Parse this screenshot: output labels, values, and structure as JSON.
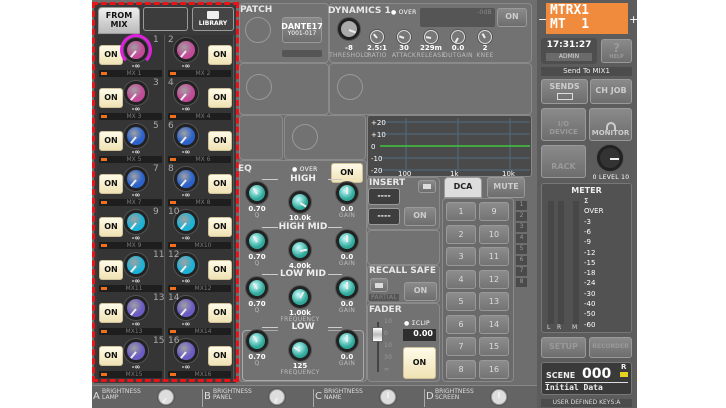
{
  "mix_panel": {
    "tabs": [
      "FROM MIX",
      "",
      "LIBRARY"
    ],
    "strips": [
      {
        "n": "1",
        "name": "MX 1",
        "level": "-∞",
        "color": "#c24a98"
      },
      {
        "n": "2",
        "name": "MX 2",
        "level": "-∞",
        "color": "#c24a98"
      },
      {
        "n": "3",
        "name": "MX 3",
        "level": "-∞",
        "color": "#c24a98"
      },
      {
        "n": "4",
        "name": "MX 4",
        "level": "-∞",
        "color": "#c24a98"
      },
      {
        "n": "5",
        "name": "MX 5",
        "level": "-∞",
        "color": "#2b62cc"
      },
      {
        "n": "6",
        "name": "MX 6",
        "level": "-∞",
        "color": "#2b62cc"
      },
      {
        "n": "7",
        "name": "MX 7",
        "level": "-∞",
        "color": "#2b62cc"
      },
      {
        "n": "8",
        "name": "MX 8",
        "level": "-∞",
        "color": "#2b62cc"
      },
      {
        "n": "9",
        "name": "MX 9",
        "level": "-∞",
        "color": "#1cb2d6"
      },
      {
        "n": "10",
        "name": "MX10",
        "level": "-∞",
        "color": "#1cb2d6"
      },
      {
        "n": "11",
        "name": "MX11",
        "level": "-∞",
        "color": "#1cb2d6"
      },
      {
        "n": "12",
        "name": "MX12",
        "level": "-∞",
        "color": "#1cb2d6"
      },
      {
        "n": "13",
        "name": "MX13",
        "level": "-∞",
        "color": "#6a5cc4"
      },
      {
        "n": "14",
        "name": "MX14",
        "level": "-∞",
        "color": "#6a5cc4"
      },
      {
        "n": "15",
        "name": "MX15",
        "level": "-∞",
        "color": "#6a5cc4"
      },
      {
        "n": "16",
        "name": "MX16",
        "level": "-∞",
        "color": "#6a5cc4"
      }
    ],
    "on_label": "ON",
    "selected_ring_color": "#e020e0"
  },
  "patch": {
    "title": "PATCH",
    "port": "DANTE17",
    "port_id": "Y001-017"
  },
  "dynamics": {
    "title": "DYNAMICS 1",
    "over": "OVER",
    "meter_label": "-0dB",
    "on": "ON",
    "params": [
      {
        "v": "-8",
        "l": "THRESHOLD"
      },
      {
        "v": "2.5:1",
        "l": "RATIO"
      },
      {
        "v": "30",
        "l": "ATTACK"
      },
      {
        "v": "229m",
        "l": "RELEASE"
      },
      {
        "v": "0.0",
        "l": "OUTGAIN"
      },
      {
        "v": "2",
        "l": "KNEE"
      }
    ]
  },
  "eq_graph": {
    "y_labels": [
      "+20",
      "+10",
      "0",
      "-10",
      "-20"
    ],
    "x_labels": [
      "100",
      "1k",
      "10k"
    ]
  },
  "eq": {
    "title": "EQ",
    "over": "OVER",
    "on": "ON",
    "bands": [
      {
        "name": "HIGH",
        "q": "0.70",
        "freq": "10.0k",
        "gain": "0.0"
      },
      {
        "name": "HIGH MID",
        "q": "0.70",
        "freq": "4.00k",
        "gain": "0.0"
      },
      {
        "name": "LOW MID",
        "q": "0.70",
        "freq": "1.00k",
        "gain": "0.0"
      },
      {
        "name": "LOW",
        "q": "0.70",
        "freq": "125",
        "gain": "0.0"
      }
    ],
    "q_label": "Q",
    "freq_label": "FREQUENCY",
    "gain_label": "GAIN"
  },
  "insert": {
    "title": "INSERT",
    "slot1": "----",
    "slot2": "----",
    "on": "ON"
  },
  "recall_safe": {
    "title": "RECALL SAFE",
    "partial": "PARTIAL",
    "on": "ON"
  },
  "fader": {
    "title": "FADER",
    "clip": "ΣCLIP",
    "value": "0.00",
    "on": "ON",
    "scale": [
      "10",
      "0",
      "10",
      "30",
      "∞"
    ]
  },
  "dca": {
    "tabs": [
      "DCA",
      "MUTE"
    ],
    "buttons": [
      "1",
      "9",
      "2",
      "10",
      "3",
      "11",
      "4",
      "12",
      "5",
      "13",
      "6",
      "14",
      "7",
      "15",
      "8",
      "16"
    ],
    "indicators": [
      "1",
      "2",
      "3",
      "4",
      "5",
      "6",
      "7",
      "8"
    ]
  },
  "right": {
    "channel_line1": "MTRX1",
    "channel_line2": "MT  1",
    "minus": "−",
    "plus": "+",
    "time": "17:31:27",
    "user": "ADMIN",
    "help": "HELP",
    "send_to": "Send To MIX1",
    "sends": "SENDS",
    "ch_job": "CH JOB",
    "io_device": "I/O DEVICE",
    "monitor": "MONITOR",
    "rack": "RACK",
    "level_min": "0",
    "level_label": "LEVEL",
    "level_max": "10",
    "meter_title": "METER",
    "meter_scale": [
      "Σ",
      "OVER",
      "-3",
      "-6",
      "-9",
      "-12",
      "-15",
      "-18",
      "-24",
      "-30",
      "-40",
      "-50",
      "-60"
    ],
    "meter_channels": [
      "L",
      "R",
      "M"
    ],
    "setup": "SETUP",
    "recorder": "RECORDER",
    "scene_label": "SCENE",
    "scene_number": "000",
    "scene_flag": "R",
    "scene_name": "Initial Data",
    "user_keys": "USER DEFINED KEYS:A",
    "accent": "#f08a3c"
  },
  "bottom": [
    {
      "k": "A",
      "l1": "BRIGHTNESS",
      "l2": "LAMP"
    },
    {
      "k": "B",
      "l1": "BRIGHTNESS",
      "l2": "PANEL"
    },
    {
      "k": "C",
      "l1": "BRIGHTNESS",
      "l2": "NAME"
    },
    {
      "k": "D",
      "l1": "BRIGHTNESS",
      "l2": "SCREEN"
    }
  ]
}
